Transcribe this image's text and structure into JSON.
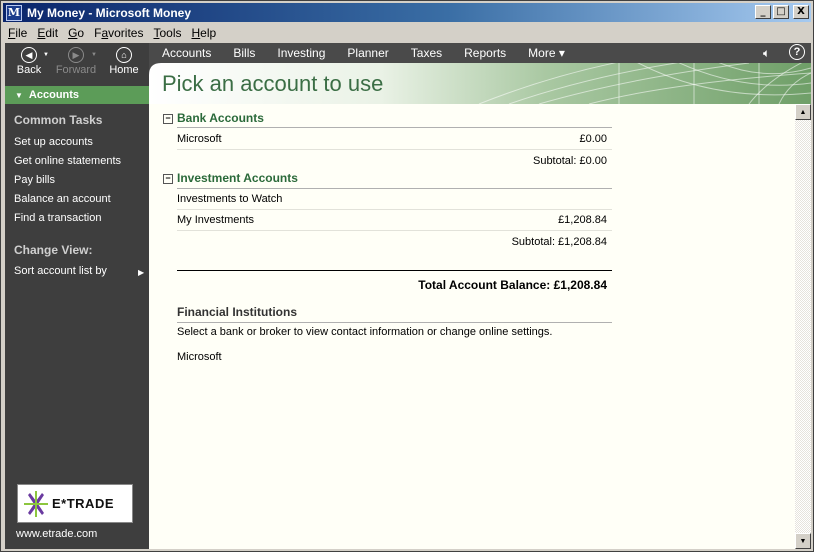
{
  "window": {
    "title": "My Money - Microsoft Money",
    "icon_letter": "M"
  },
  "window_buttons": {
    "minimize": "_",
    "maximize": "□",
    "close": "X"
  },
  "menu": [
    {
      "label": "File",
      "u": "F",
      "rest": "ile"
    },
    {
      "label": "Edit",
      "u": "E",
      "rest": "dit"
    },
    {
      "label": "Go",
      "u": "G",
      "rest": "o"
    },
    {
      "label": "Favorites",
      "pre": "F",
      "u": "a",
      "rest": "vorites"
    },
    {
      "label": "Tools",
      "u": "T",
      "rest": "ools"
    },
    {
      "label": "Help",
      "u": "H",
      "rest": "elp"
    }
  ],
  "nav": {
    "back": "Back",
    "forward": "Forward",
    "home": "Home"
  },
  "tabs": [
    "Accounts",
    "Bills",
    "Investing",
    "Planner",
    "Taxes",
    "Reports",
    "More ▾"
  ],
  "sidebar": {
    "header": "Accounts",
    "common_tasks_title": "Common Tasks",
    "tasks": [
      "Set up accounts",
      "Get online statements",
      "Pay bills",
      "Balance an account",
      "Find a transaction"
    ],
    "change_view_title": "Change View:",
    "view_items": [
      "Sort account list by"
    ],
    "ad_brand": "E*TRADE",
    "ad_url": "www.etrade.com"
  },
  "page": {
    "title": "Pick an account to use"
  },
  "bank": {
    "title": "Bank Accounts",
    "rows": [
      {
        "name": "Microsoft",
        "amount": "£0.00"
      }
    ],
    "subtotal": "Subtotal: £0.00"
  },
  "investment": {
    "title": "Investment Accounts",
    "rows": [
      {
        "name": "Investments to Watch",
        "amount": ""
      },
      {
        "name": "My Investments",
        "amount": "£1,208.84"
      }
    ],
    "subtotal": "Subtotal: £1,208.84"
  },
  "total": "Total Account Balance: £1,208.84",
  "institutions": {
    "title": "Financial Institutions",
    "description": "Select a bank or broker to view contact information or change online settings.",
    "items": [
      "Microsoft"
    ]
  },
  "colors": {
    "accent": "#5c9c58",
    "title_green": "#3b6e45",
    "sidebar": "#3e3e3e"
  }
}
